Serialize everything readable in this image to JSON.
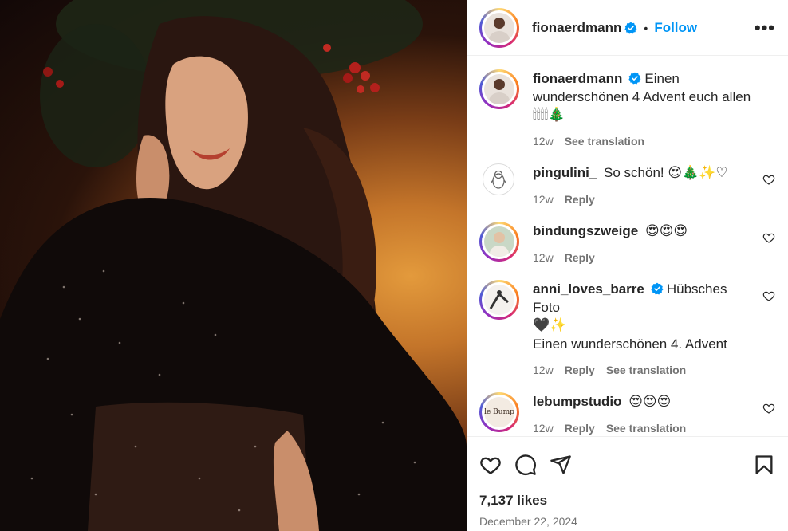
{
  "post": {
    "username": "fionaerdmann",
    "follow_label": "Follow",
    "dot": "•",
    "more": "•••"
  },
  "caption": {
    "username": "fionaerdmann",
    "text": "Einen wunderschönen 4 Advent euch allen",
    "emoji": "🕯🕯🕯🕯🎄",
    "time": "12w",
    "see_translation": "See translation"
  },
  "comments": [
    {
      "username": "pingulini_",
      "text": "So schön!",
      "emoji": "😍🎄✨♡",
      "time": "12w",
      "reply": "Reply",
      "avatar_icon": "penguin-icon"
    },
    {
      "username": "bindungszweige",
      "text": "",
      "emoji": "😍😍😍",
      "time": "12w",
      "reply": "Reply",
      "avatar_icon": "profile-photo"
    },
    {
      "username": "anni_loves_barre",
      "text": "Hübsches Foto",
      "emoji": "🖤✨",
      "text2": "Einen wunderschönen 4. Advent",
      "time": "12w",
      "reply": "Reply",
      "see_translation": "See translation",
      "avatar_icon": "profile-photo"
    },
    {
      "username": "lebumpstudio",
      "text": "",
      "emoji": "😍😍😍",
      "time": "12w",
      "reply": "Reply",
      "see_translation": "See translation",
      "avatar_logo": "le Bump"
    }
  ],
  "footer": {
    "likes": "7,137 likes",
    "date": "December 22, 2024"
  },
  "colors": {
    "accent": "#0095f6",
    "verified": "#0095f6",
    "text": "#262626",
    "muted": "#737373"
  }
}
